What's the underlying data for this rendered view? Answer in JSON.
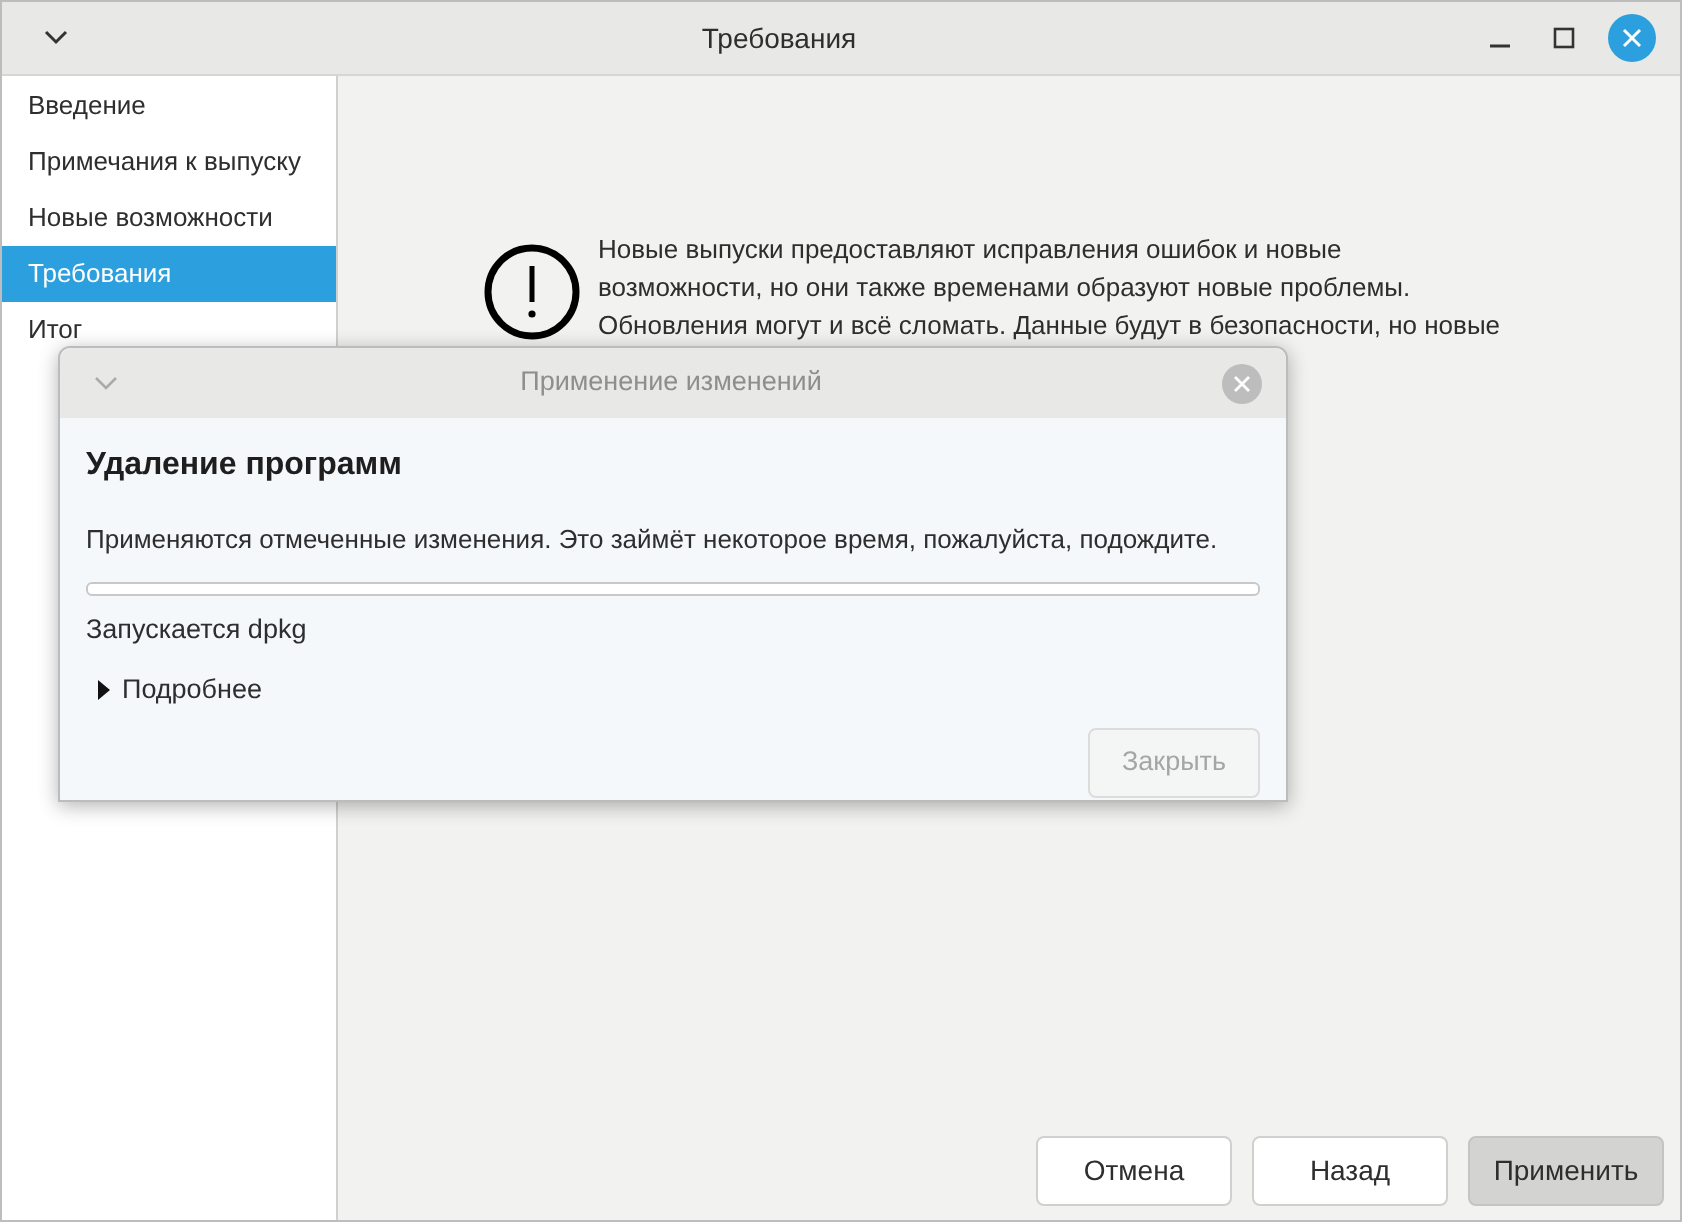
{
  "window": {
    "title": "Требования"
  },
  "sidebar": {
    "items": [
      {
        "label": "Введение",
        "selected": false
      },
      {
        "label": "Примечания к выпуску",
        "selected": false
      },
      {
        "label": "Новые возможности",
        "selected": false
      },
      {
        "label": "Требования",
        "selected": true
      },
      {
        "label": "Итог",
        "selected": false
      }
    ]
  },
  "warning": {
    "lines": [
      "Новые выпуски предоставляют исправления ошибок и новые",
      "возможности, но они также временами образуют новые проблемы.",
      "Обновления могут и всё сломать. Данные будут в безопасности, но новые"
    ]
  },
  "buttons": [
    {
      "label": "Отмена",
      "kind": "normal"
    },
    {
      "label": "Назад",
      "kind": "normal"
    },
    {
      "label": "Применить",
      "kind": "default"
    }
  ],
  "dialog": {
    "title": "Применение изменений",
    "heading": "Удаление программ",
    "message": "Применяются отмеченные изменения. Это займёт некоторое время, пожалуйста, подождите.",
    "progress": {
      "level": 0
    },
    "status": "Запускается dpkg",
    "details": {
      "label": "Подробнее",
      "expanded": false
    },
    "close_button": {
      "label": "Закрыть",
      "disabled": true
    }
  }
}
